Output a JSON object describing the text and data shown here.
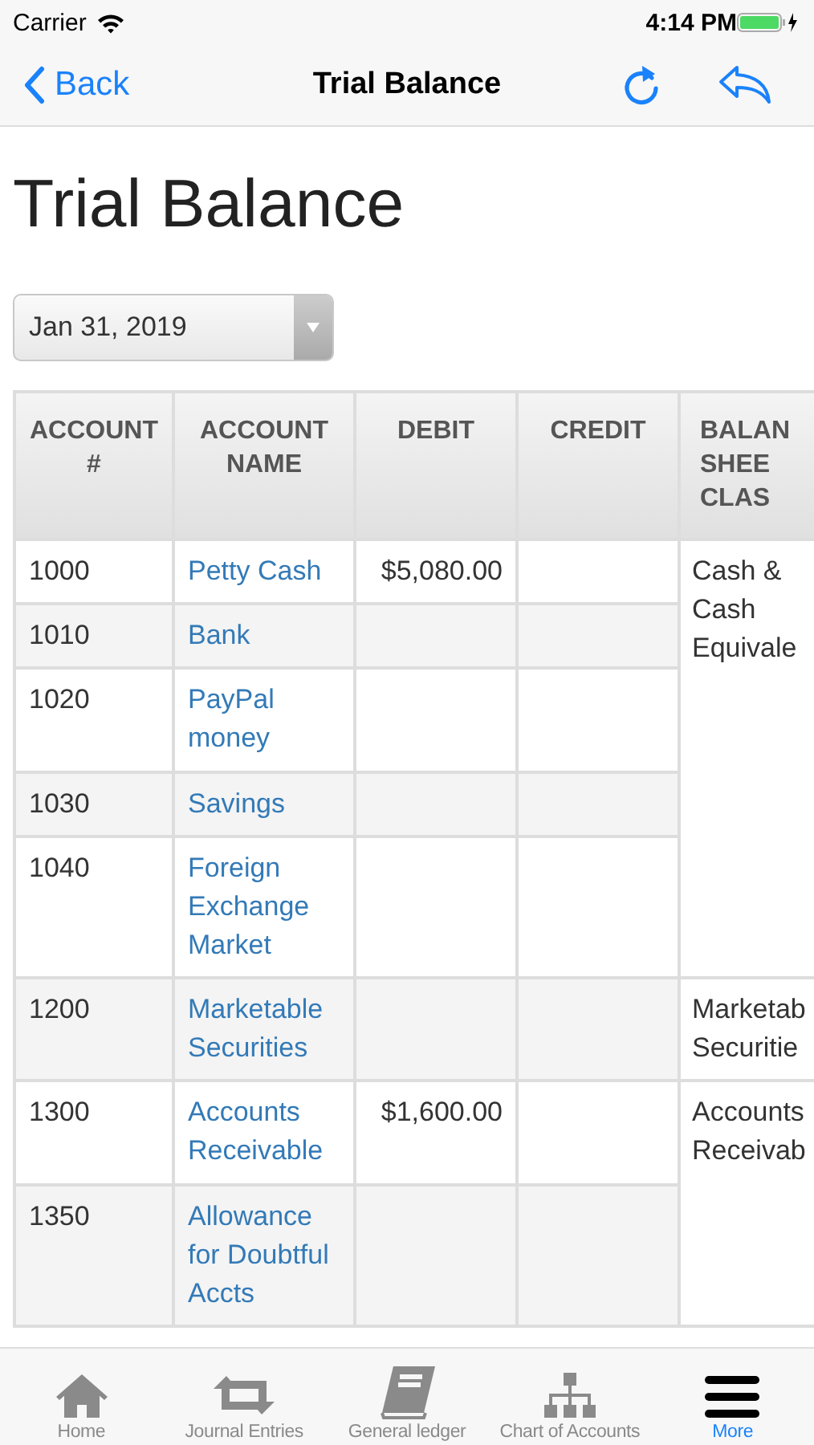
{
  "status_bar": {
    "carrier": "Carrier",
    "time": "4:14 PM"
  },
  "nav": {
    "back": "Back",
    "title": "Trial Balance"
  },
  "heading": "Trial Balance",
  "date_select": {
    "value": "Jan 31, 2019"
  },
  "table": {
    "columns": [
      "ACCOUNT #",
      "ACCOUNT NAME",
      "DEBIT",
      "CREDIT",
      "BALAN SHEE CLAS"
    ],
    "groups": [
      {
        "class": "Cash & Cash Equivale",
        "rows": [
          {
            "number": "1000",
            "name": "Petty Cash",
            "debit": "$5,080.00"
          },
          {
            "number": "1010",
            "name": "Bank"
          },
          {
            "number": "1020",
            "name": "PayPal money"
          },
          {
            "number": "1030",
            "name": "Savings"
          },
          {
            "number": "1040",
            "name": "Foreign Exchange Market"
          }
        ]
      },
      {
        "class": "Marketab Securitie",
        "rows": [
          {
            "number": "1200",
            "name": "Marketable Securities"
          }
        ]
      },
      {
        "class": "Accounts Receivab",
        "rows": [
          {
            "number": "1300",
            "name": "Accounts Receivable",
            "debit": "$1,600.00"
          },
          {
            "number": "1350",
            "name": "Allowance for Doubtful Accts"
          }
        ]
      }
    ]
  },
  "tabs": [
    {
      "label": "Home",
      "selected": false
    },
    {
      "label": "Journal Entries",
      "selected": false
    },
    {
      "label": "General ledger",
      "selected": false
    },
    {
      "label": "Chart of Accounts",
      "selected": false
    },
    {
      "label": "More",
      "selected": true
    }
  ]
}
